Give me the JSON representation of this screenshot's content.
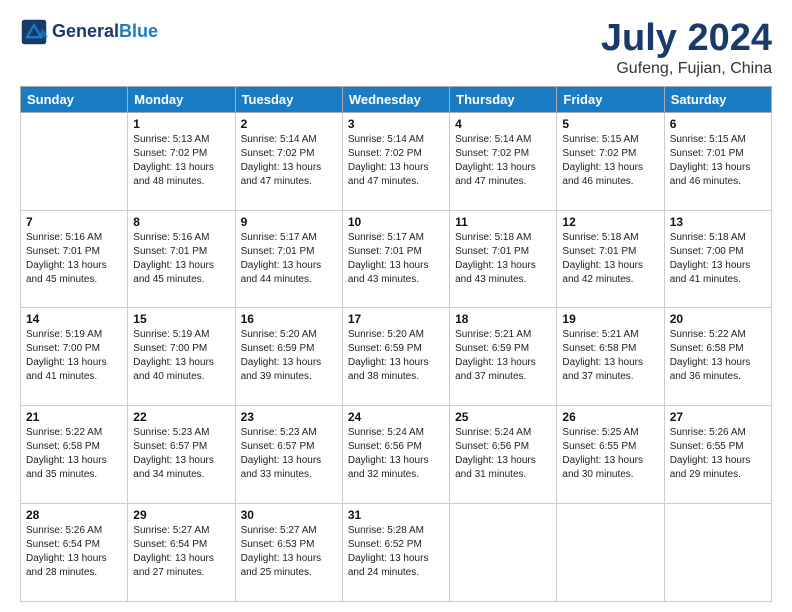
{
  "header": {
    "logo_line1": "General",
    "logo_line2": "Blue",
    "main_title": "July 2024",
    "subtitle": "Gufeng, Fujian, China"
  },
  "weekdays": [
    "Sunday",
    "Monday",
    "Tuesday",
    "Wednesday",
    "Thursday",
    "Friday",
    "Saturday"
  ],
  "weeks": [
    [
      {
        "day": "",
        "text": ""
      },
      {
        "day": "1",
        "text": "Sunrise: 5:13 AM\nSunset: 7:02 PM\nDaylight: 13 hours\nand 48 minutes."
      },
      {
        "day": "2",
        "text": "Sunrise: 5:14 AM\nSunset: 7:02 PM\nDaylight: 13 hours\nand 47 minutes."
      },
      {
        "day": "3",
        "text": "Sunrise: 5:14 AM\nSunset: 7:02 PM\nDaylight: 13 hours\nand 47 minutes."
      },
      {
        "day": "4",
        "text": "Sunrise: 5:14 AM\nSunset: 7:02 PM\nDaylight: 13 hours\nand 47 minutes."
      },
      {
        "day": "5",
        "text": "Sunrise: 5:15 AM\nSunset: 7:02 PM\nDaylight: 13 hours\nand 46 minutes."
      },
      {
        "day": "6",
        "text": "Sunrise: 5:15 AM\nSunset: 7:01 PM\nDaylight: 13 hours\nand 46 minutes."
      }
    ],
    [
      {
        "day": "7",
        "text": "Sunrise: 5:16 AM\nSunset: 7:01 PM\nDaylight: 13 hours\nand 45 minutes."
      },
      {
        "day": "8",
        "text": "Sunrise: 5:16 AM\nSunset: 7:01 PM\nDaylight: 13 hours\nand 45 minutes."
      },
      {
        "day": "9",
        "text": "Sunrise: 5:17 AM\nSunset: 7:01 PM\nDaylight: 13 hours\nand 44 minutes."
      },
      {
        "day": "10",
        "text": "Sunrise: 5:17 AM\nSunset: 7:01 PM\nDaylight: 13 hours\nand 43 minutes."
      },
      {
        "day": "11",
        "text": "Sunrise: 5:18 AM\nSunset: 7:01 PM\nDaylight: 13 hours\nand 43 minutes."
      },
      {
        "day": "12",
        "text": "Sunrise: 5:18 AM\nSunset: 7:01 PM\nDaylight: 13 hours\nand 42 minutes."
      },
      {
        "day": "13",
        "text": "Sunrise: 5:18 AM\nSunset: 7:00 PM\nDaylight: 13 hours\nand 41 minutes."
      }
    ],
    [
      {
        "day": "14",
        "text": "Sunrise: 5:19 AM\nSunset: 7:00 PM\nDaylight: 13 hours\nand 41 minutes."
      },
      {
        "day": "15",
        "text": "Sunrise: 5:19 AM\nSunset: 7:00 PM\nDaylight: 13 hours\nand 40 minutes."
      },
      {
        "day": "16",
        "text": "Sunrise: 5:20 AM\nSunset: 6:59 PM\nDaylight: 13 hours\nand 39 minutes."
      },
      {
        "day": "17",
        "text": "Sunrise: 5:20 AM\nSunset: 6:59 PM\nDaylight: 13 hours\nand 38 minutes."
      },
      {
        "day": "18",
        "text": "Sunrise: 5:21 AM\nSunset: 6:59 PM\nDaylight: 13 hours\nand 37 minutes."
      },
      {
        "day": "19",
        "text": "Sunrise: 5:21 AM\nSunset: 6:58 PM\nDaylight: 13 hours\nand 37 minutes."
      },
      {
        "day": "20",
        "text": "Sunrise: 5:22 AM\nSunset: 6:58 PM\nDaylight: 13 hours\nand 36 minutes."
      }
    ],
    [
      {
        "day": "21",
        "text": "Sunrise: 5:22 AM\nSunset: 6:58 PM\nDaylight: 13 hours\nand 35 minutes."
      },
      {
        "day": "22",
        "text": "Sunrise: 5:23 AM\nSunset: 6:57 PM\nDaylight: 13 hours\nand 34 minutes."
      },
      {
        "day": "23",
        "text": "Sunrise: 5:23 AM\nSunset: 6:57 PM\nDaylight: 13 hours\nand 33 minutes."
      },
      {
        "day": "24",
        "text": "Sunrise: 5:24 AM\nSunset: 6:56 PM\nDaylight: 13 hours\nand 32 minutes."
      },
      {
        "day": "25",
        "text": "Sunrise: 5:24 AM\nSunset: 6:56 PM\nDaylight: 13 hours\nand 31 minutes."
      },
      {
        "day": "26",
        "text": "Sunrise: 5:25 AM\nSunset: 6:55 PM\nDaylight: 13 hours\nand 30 minutes."
      },
      {
        "day": "27",
        "text": "Sunrise: 5:26 AM\nSunset: 6:55 PM\nDaylight: 13 hours\nand 29 minutes."
      }
    ],
    [
      {
        "day": "28",
        "text": "Sunrise: 5:26 AM\nSunset: 6:54 PM\nDaylight: 13 hours\nand 28 minutes."
      },
      {
        "day": "29",
        "text": "Sunrise: 5:27 AM\nSunset: 6:54 PM\nDaylight: 13 hours\nand 27 minutes."
      },
      {
        "day": "30",
        "text": "Sunrise: 5:27 AM\nSunset: 6:53 PM\nDaylight: 13 hours\nand 25 minutes."
      },
      {
        "day": "31",
        "text": "Sunrise: 5:28 AM\nSunset: 6:52 PM\nDaylight: 13 hours\nand 24 minutes."
      },
      {
        "day": "",
        "text": ""
      },
      {
        "day": "",
        "text": ""
      },
      {
        "day": "",
        "text": ""
      }
    ]
  ]
}
